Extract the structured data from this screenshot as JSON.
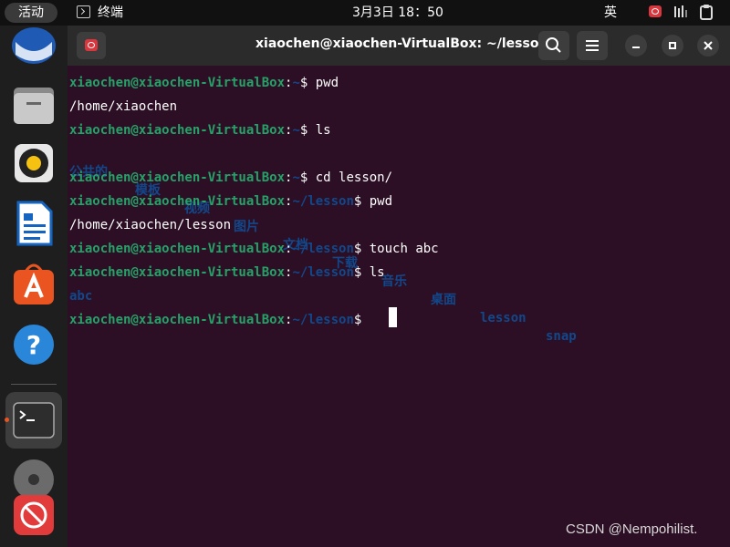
{
  "topbar": {
    "activities": "活动",
    "app_name": "终端",
    "clock": "3月3日  18：50",
    "input_method": "英"
  },
  "window": {
    "title": "xiaochen@xiaochen-VirtualBox: ~/lesson",
    "buttons": [
      "search-icon",
      "hamburger-menu-icon",
      "minimize-icon",
      "maximize-icon",
      "close-icon"
    ]
  },
  "terminal": {
    "user_host": "xiaochen@xiaochen-VirtualBox",
    "lines": [
      {
        "path": "~",
        "cmd": "pwd"
      },
      {
        "output": "/home/xiaochen"
      },
      {
        "path": "~",
        "cmd": "ls"
      },
      {
        "dirs": [
          "公共的",
          "模板",
          "视频",
          "图片",
          "文档",
          "下载",
          "音乐",
          "桌面",
          "lesson",
          "snap"
        ]
      },
      {
        "path": "~",
        "cmd": "cd lesson/"
      },
      {
        "path": "~/lesson",
        "cmd": "pwd"
      },
      {
        "output": "/home/xiaochen/lesson"
      },
      {
        "path": "~/lesson",
        "cmd": "touch abc"
      },
      {
        "path": "~/lesson",
        "cmd": "ls"
      },
      {
        "dirs": [
          "abc"
        ]
      },
      {
        "path": "~/lesson",
        "cmd": ""
      }
    ]
  },
  "dock": {
    "items": [
      "thunderbird-icon",
      "files-icon",
      "rhythmbox-icon",
      "libreoffice-writer-icon",
      "app-center-icon",
      "help-icon",
      "terminal-icon",
      "disc-icon",
      "blocked-icon"
    ]
  },
  "watermark": "CSDN @Nempohilist.",
  "colors": {
    "terminal_bg": "#2c0f24",
    "user_green": "#26a269",
    "path_blue": "#12488b"
  }
}
